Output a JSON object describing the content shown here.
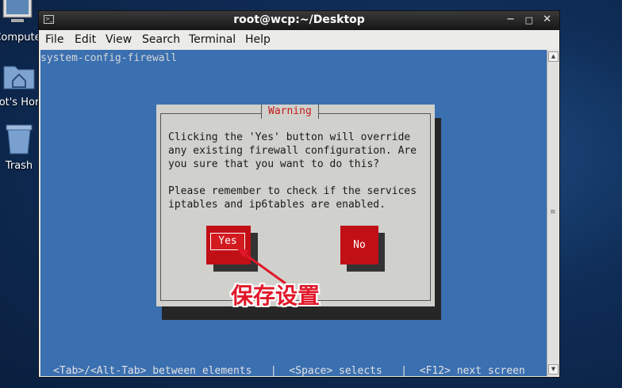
{
  "desktop": {
    "icons": [
      {
        "label": "Compute"
      },
      {
        "label": "ot's Hor"
      },
      {
        "label": "Trash"
      }
    ]
  },
  "window": {
    "title": "root@wcp:~/Desktop",
    "controls": {
      "minimize": "−",
      "maximize": "□",
      "close": "✕"
    }
  },
  "menubar": {
    "items": [
      "File",
      "Edit",
      "View",
      "Search",
      "Terminal",
      "Help"
    ]
  },
  "terminal": {
    "command": "system-config-firewall",
    "footer": "<Tab>/<Alt-Tab> between elements   |  <Space> selects   |  <F12> next screen"
  },
  "dialog": {
    "title": "Warning",
    "message": "Clicking the 'Yes' button will override\nany existing firewall configuration. Are\nyou sure that you want to do this?\n\nPlease remember to check if the services\niptables and ip6tables are enabled.",
    "yes_label": "Yes",
    "no_label": "No"
  },
  "annotation": {
    "text": "保存设置",
    "color": "#e0182a"
  },
  "colors": {
    "terminal_bg": "#3a6fb0",
    "dialog_bg": "#d0d0cc",
    "button_red": "#c10f16",
    "warning_title": "#c41a1a"
  }
}
